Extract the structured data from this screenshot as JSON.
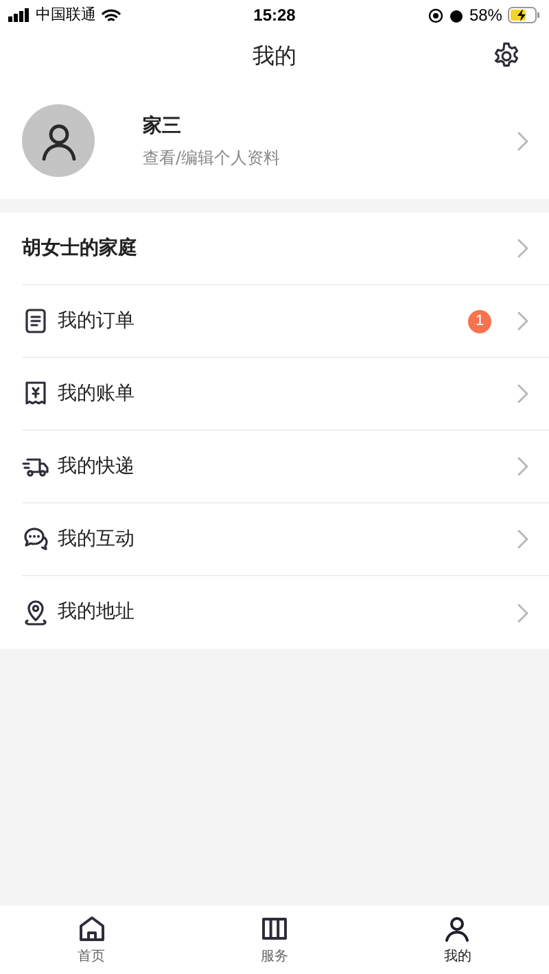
{
  "status_bar": {
    "carrier": "中国联通",
    "time": "15:28",
    "battery": "58%"
  },
  "header": {
    "title": "我的"
  },
  "profile": {
    "name": "家三",
    "subtitle": "查看/编辑个人资料"
  },
  "menu": [
    {
      "kind": "family",
      "label": "胡女士的家庭"
    },
    {
      "kind": "order",
      "label": "我的订单",
      "badge": "1"
    },
    {
      "kind": "bill",
      "label": "我的账单"
    },
    {
      "kind": "delivery",
      "label": "我的快递"
    },
    {
      "kind": "chat",
      "label": "我的互动"
    },
    {
      "kind": "address",
      "label": "我的地址"
    }
  ],
  "tab_bar": [
    {
      "kind": "home",
      "label": "首页",
      "selected": false
    },
    {
      "kind": "service",
      "label": "服务",
      "selected": false
    },
    {
      "kind": "me",
      "label": "我的",
      "selected": true
    }
  ]
}
